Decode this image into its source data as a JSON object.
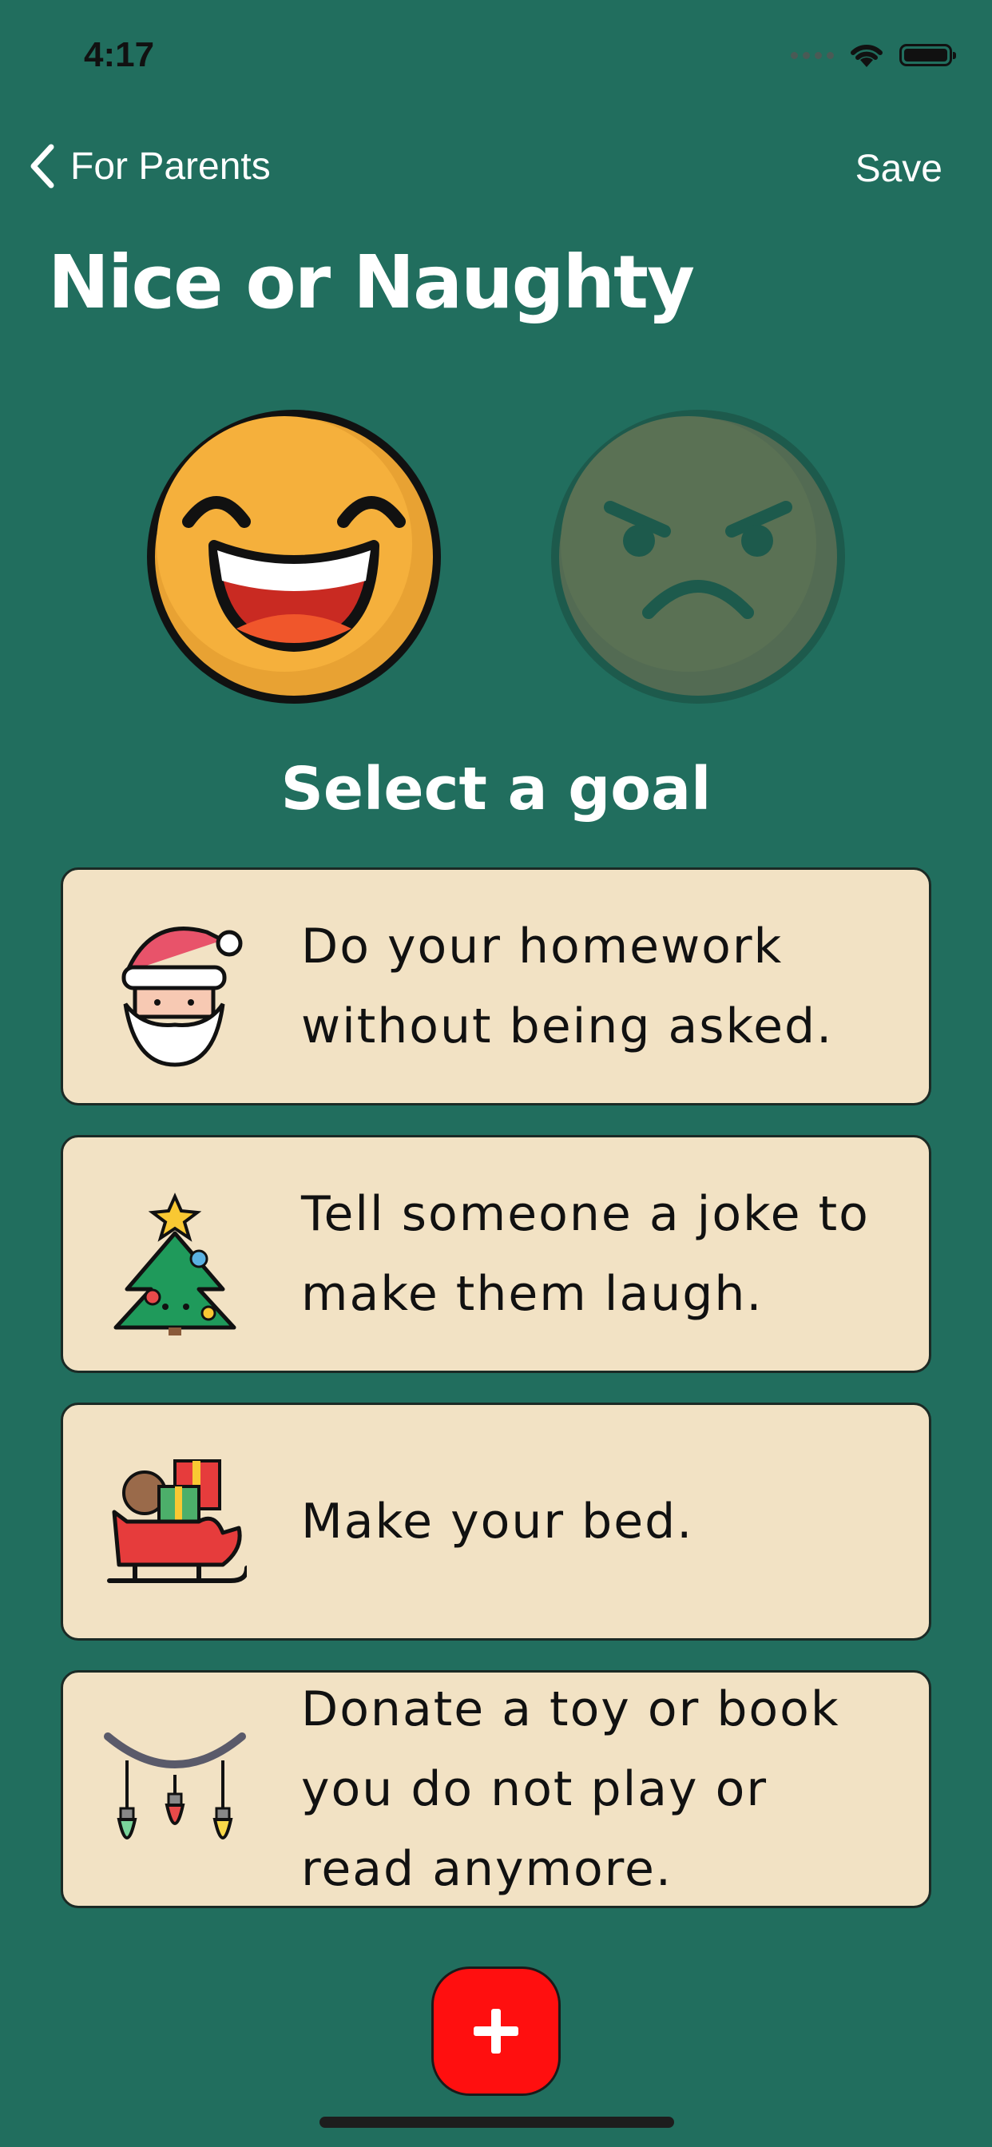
{
  "status_bar": {
    "time": "4:17"
  },
  "nav": {
    "back_label": "For Parents",
    "save_label": "Save"
  },
  "page": {
    "title": "Nice or Naughty",
    "section_title": "Select a goal"
  },
  "faces": {
    "nice": {
      "name": "nice-face-icon",
      "selected": true
    },
    "naughty": {
      "name": "naughty-face-icon",
      "selected": false
    }
  },
  "goals": [
    {
      "icon": "santa-icon",
      "text": "Do your homework without being asked."
    },
    {
      "icon": "christmas-tree-icon",
      "text": "Tell someone a joke to make them laugh."
    },
    {
      "icon": "sleigh-icon",
      "text": "Make your bed."
    },
    {
      "icon": "christmas-lights-icon",
      "text": "Donate a toy or book you do not play or read anymore."
    }
  ],
  "add_button": {
    "icon": "plus-icon"
  },
  "colors": {
    "background": "#216e5e",
    "card": "#f2e2c4",
    "accent": "#ff0f0f"
  }
}
